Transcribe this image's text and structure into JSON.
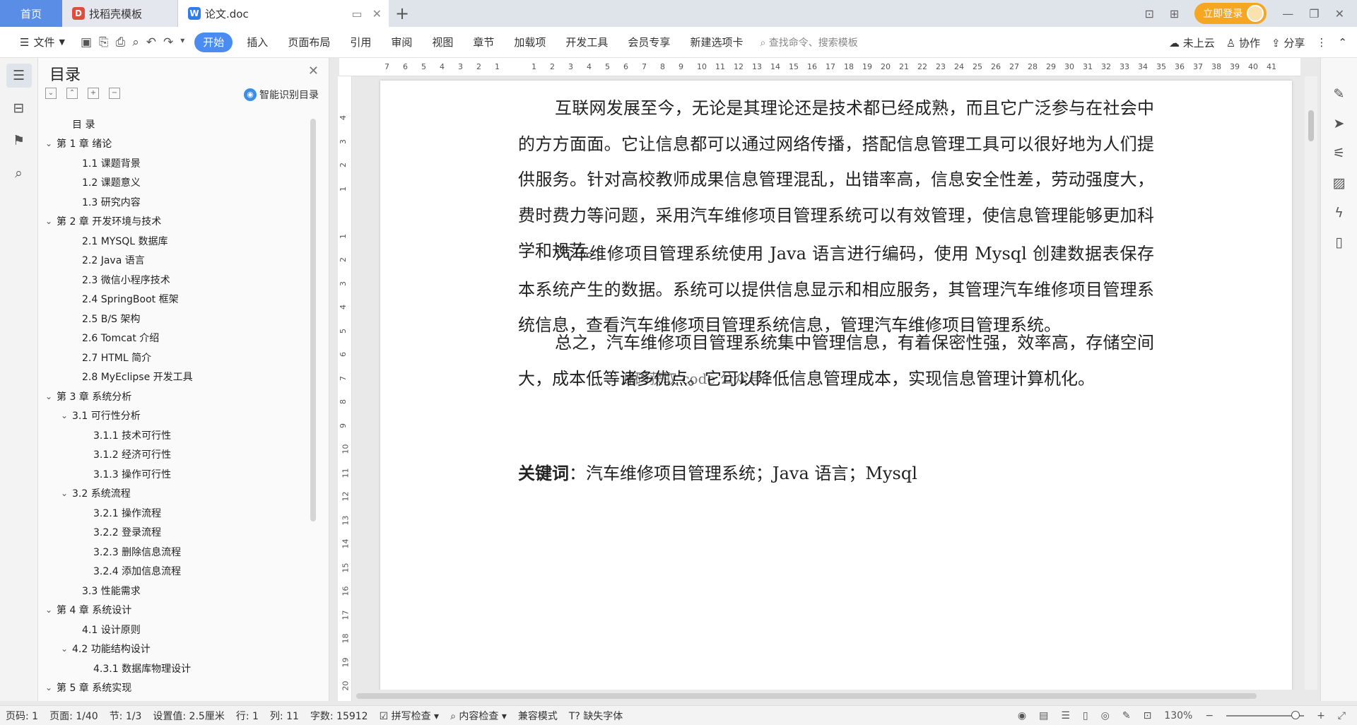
{
  "tabs": [
    {
      "label": "首页"
    },
    {
      "label": "找稻壳模板",
      "icon": "daoke-logo-icon"
    },
    {
      "label": "论文.doc",
      "icon": "wps-writer-icon"
    }
  ],
  "login": {
    "label": "立即登录"
  },
  "ribbon": {
    "file_label": "文件",
    "tabs": [
      "开始",
      "插入",
      "页面布局",
      "引用",
      "审阅",
      "视图",
      "章节",
      "加载项",
      "开发工具",
      "会员专享",
      "新建选项卡"
    ],
    "active_tab": "开始",
    "search_placeholder": "查找命令、搜索模板",
    "cloud_label": "未上云",
    "collab_label": "协作",
    "share_label": "分享"
  },
  "toc": {
    "title": "目录",
    "smart_label": "智能识别目录",
    "items": [
      {
        "text": "目  录",
        "level": 1,
        "caret": ""
      },
      {
        "text": "第 1 章  绪论",
        "level": 0,
        "caret": "⌄"
      },
      {
        "text": "1.1  课题背景",
        "level": 2,
        "caret": ""
      },
      {
        "text": "1.2  课题意义",
        "level": 2,
        "caret": ""
      },
      {
        "text": "1.3  研究内容",
        "level": 2,
        "caret": ""
      },
      {
        "text": "第 2 章  开发环境与技术",
        "level": 0,
        "caret": "⌄"
      },
      {
        "text": "2.1 MYSQL 数据库",
        "level": 2,
        "caret": ""
      },
      {
        "text": "2.2 Java 语言",
        "level": 2,
        "caret": ""
      },
      {
        "text": "2.3  微信小程序技术",
        "level": 2,
        "caret": ""
      },
      {
        "text": "2.4 SpringBoot 框架",
        "level": 2,
        "caret": ""
      },
      {
        "text": "2.5 B/S 架构",
        "level": 2,
        "caret": ""
      },
      {
        "text": "2.6 Tomcat  介绍",
        "level": 2,
        "caret": ""
      },
      {
        "text": "2.7 HTML 简介",
        "level": 2,
        "caret": ""
      },
      {
        "text": "2.8 MyEclipse 开发工具",
        "level": 2,
        "caret": ""
      },
      {
        "text": "第 3 章  系统分析",
        "level": 0,
        "caret": "⌄"
      },
      {
        "text": "3.1  可行性分析",
        "level": 1,
        "caret": "⌄"
      },
      {
        "text": "3.1.1  技术可行性",
        "level": 3,
        "caret": ""
      },
      {
        "text": "3.1.2  经济可行性",
        "level": 3,
        "caret": ""
      },
      {
        "text": "3.1.3  操作可行性",
        "level": 3,
        "caret": ""
      },
      {
        "text": "3.2  系统流程",
        "level": 1,
        "caret": "⌄"
      },
      {
        "text": "3.2.1  操作流程",
        "level": 3,
        "caret": ""
      },
      {
        "text": "3.2.2  登录流程",
        "level": 3,
        "caret": ""
      },
      {
        "text": "3.2.3  删除信息流程",
        "level": 3,
        "caret": ""
      },
      {
        "text": "3.2.4  添加信息流程",
        "level": 3,
        "caret": ""
      },
      {
        "text": "3.3  性能需求",
        "level": 2,
        "caret": ""
      },
      {
        "text": "第 4 章  系统设计",
        "level": 0,
        "caret": "⌄"
      },
      {
        "text": "4.1  设计原则",
        "level": 2,
        "caret": ""
      },
      {
        "text": "4.2  功能结构设计",
        "level": 1,
        "caret": "⌄"
      },
      {
        "text": "4.3.1  数据库物理设计",
        "level": 3,
        "caret": ""
      },
      {
        "text": "第 5 章  系统实现",
        "level": 0,
        "caret": "⌄"
      }
    ]
  },
  "ruler": {
    "h_ticks": [
      "7",
      "6",
      "5",
      "4",
      "3",
      "2",
      "1",
      "",
      "1",
      "2",
      "3",
      "4",
      "5",
      "6",
      "7",
      "8",
      "9",
      "10",
      "11",
      "12",
      "13",
      "14",
      "15",
      "16",
      "17",
      "18",
      "19",
      "20",
      "21",
      "22",
      "23",
      "24",
      "25",
      "26",
      "27",
      "28",
      "29",
      "30",
      "31",
      "32",
      "33",
      "34",
      "35",
      "36",
      "37",
      "38",
      "39",
      "40",
      "41"
    ],
    "v_ticks": [
      "4",
      "3",
      "2",
      "1",
      "",
      "1",
      "2",
      "3",
      "4",
      "5",
      "6",
      "7",
      "8",
      "9",
      "10",
      "11",
      "12",
      "13",
      "14",
      "15",
      "16",
      "17",
      "18",
      "19",
      "20"
    ]
  },
  "document": {
    "paragraphs": [
      "互联网发展至今，无论是其理论还是技术都已经成熟，而且它广泛参与在社会中的方方面面。它让信息都可以通过网络传播，搭配信息管理工具可以很好地为人们提供服务。针对高校教师成果信息管理混乱，出错率高，信息安全性差，劳动强度大，费时费力等问题，采用汽车维修项目管理系统可以有效管理，使信息管理能够更加科学和规范。",
      "汽车维修项目管理系统使用 Java 语言进行编码，使用 Mysql 创建数据表保存本系统产生的数据。系统可以提供信息显示和相应服务，其管理汽车维修项目管理系统信息，查看汽车维修项目管理系统信息，管理汽车维修项目管理系统。",
      "总之，汽车维修项目管理系统集中管理信息，有着保密性强，效率高，存储空间大，成本低等诸多优点。它可以降低信息管理成本，实现信息管理计算机化。"
    ],
    "keywords_label": "关键词",
    "keywords_text": "：汽车维修项目管理系统；Java 语言；Mysql",
    "watermark": "源码获取 code 公众号"
  },
  "status": {
    "page_code": "页码: 1",
    "page": "页面: 1/40",
    "section": "节: 1/3",
    "setting": "设置值: 2.5厘米",
    "row": "行: 1",
    "col": "列: 11",
    "word_count": "字数: 15912",
    "spell_check": "拼写检查",
    "content_check": "内容检查",
    "compat_mode": "兼容模式",
    "missing_font": "缺失字体",
    "zoom": "130%"
  }
}
